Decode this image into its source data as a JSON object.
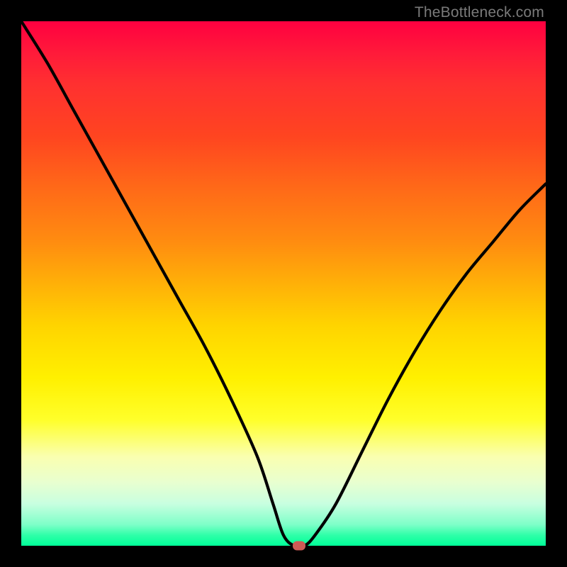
{
  "credit": "TheBottleneck.com",
  "colors": {
    "frame_bg": "#000000",
    "curve_stroke": "#000000",
    "marker_fill": "#cd5a55",
    "credit_text": "#7a7a7a"
  },
  "chart_data": {
    "type": "line",
    "title": "",
    "xlabel": "",
    "ylabel": "",
    "xlim": [
      0,
      100
    ],
    "ylim": [
      0,
      100
    ],
    "series": [
      {
        "name": "bottleneck-curve",
        "x": [
          0,
          5,
          10,
          15,
          20,
          25,
          30,
          35,
          40,
          45,
          48,
          50,
          52,
          54,
          56,
          60,
          65,
          70,
          75,
          80,
          85,
          90,
          95,
          100
        ],
        "values": [
          100,
          92,
          83,
          74,
          65,
          56,
          47,
          38,
          28,
          17,
          8,
          2,
          0,
          0,
          2,
          8,
          18,
          28,
          37,
          45,
          52,
          58,
          64,
          69
        ]
      }
    ],
    "marker": {
      "x": 53,
      "y": 0
    }
  }
}
